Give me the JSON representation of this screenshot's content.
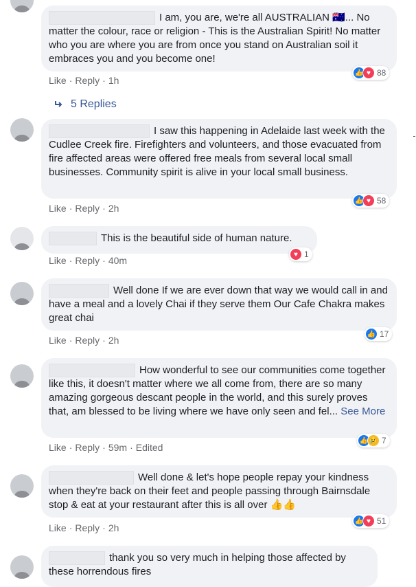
{
  "comments": [
    {
      "text": "I am, you are, we're all AUSTRALIAN 🇦🇺... No matter the colour, race or religion - This is the Australian Spirit! No matter who you are where you are from once you stand on Australian soil it embraces you and you become one!",
      "reactions": {
        "icons": [
          "like-icon",
          "love-icon"
        ],
        "count": "88"
      },
      "actions": {
        "like": "Like",
        "reply": "Reply",
        "time": "1h"
      }
    },
    {
      "text": "I saw this happening in Adelaide last week with the Cudlee Creek fire. Firefighters and volunteers, and those evacuated from fire affected areas were offered free meals from several local small businesses. Community spirit is alive in your local small business.",
      "reactions": {
        "icons": [
          "like-icon",
          "love-icon"
        ],
        "count": "58"
      },
      "actions": {
        "like": "Like",
        "reply": "Reply",
        "time": "2h"
      }
    },
    {
      "text": "This is the beautiful side of human nature.",
      "reactions": {
        "icons": [
          "love-icon"
        ],
        "count": "1"
      },
      "actions": {
        "like": "Like",
        "reply": "Reply",
        "time": "40m"
      }
    },
    {
      "text": "Well done If we are ever down that way we would call in and have a meal and a lovely Chai if they serve them Our Cafe Chakra makes great chai",
      "reactions": {
        "icons": [
          "like-icon"
        ],
        "count": "17"
      },
      "actions": {
        "like": "Like",
        "reply": "Reply",
        "time": "2h"
      }
    },
    {
      "text": "How wonderful to see our communities come together like this, it doesn't matter where we all come from, there are so many amazing gorgeous descant people in the world, and this surely proves that, am blessed to be living where we have only seen and fel...",
      "see_more": "See More",
      "reactions": {
        "icons": [
          "like-icon",
          "sad-icon"
        ],
        "count": "7"
      },
      "actions": {
        "like": "Like",
        "reply": "Reply",
        "time": "59m",
        "edited": "Edited"
      }
    },
    {
      "text": "Well done & let's hope people repay your kindness when they're back on their feet and people passing through Bairnsdale stop & eat at your restaurant after this is all over 👍👍",
      "reactions": {
        "icons": [
          "like-icon",
          "love-icon"
        ],
        "count": "51"
      },
      "actions": {
        "like": "Like",
        "reply": "Reply",
        "time": "2h"
      }
    },
    {
      "text": "thank you so very much in helping those affected by these horrendous fires"
    }
  ],
  "replies": {
    "label": "5 Replies",
    "icon": "reply-arrow-icon"
  },
  "colors": {
    "bubble": "#f0f2f5",
    "link": "#385898",
    "meta": "#65676b",
    "like": "#1877f2",
    "love": "#f33e58"
  }
}
